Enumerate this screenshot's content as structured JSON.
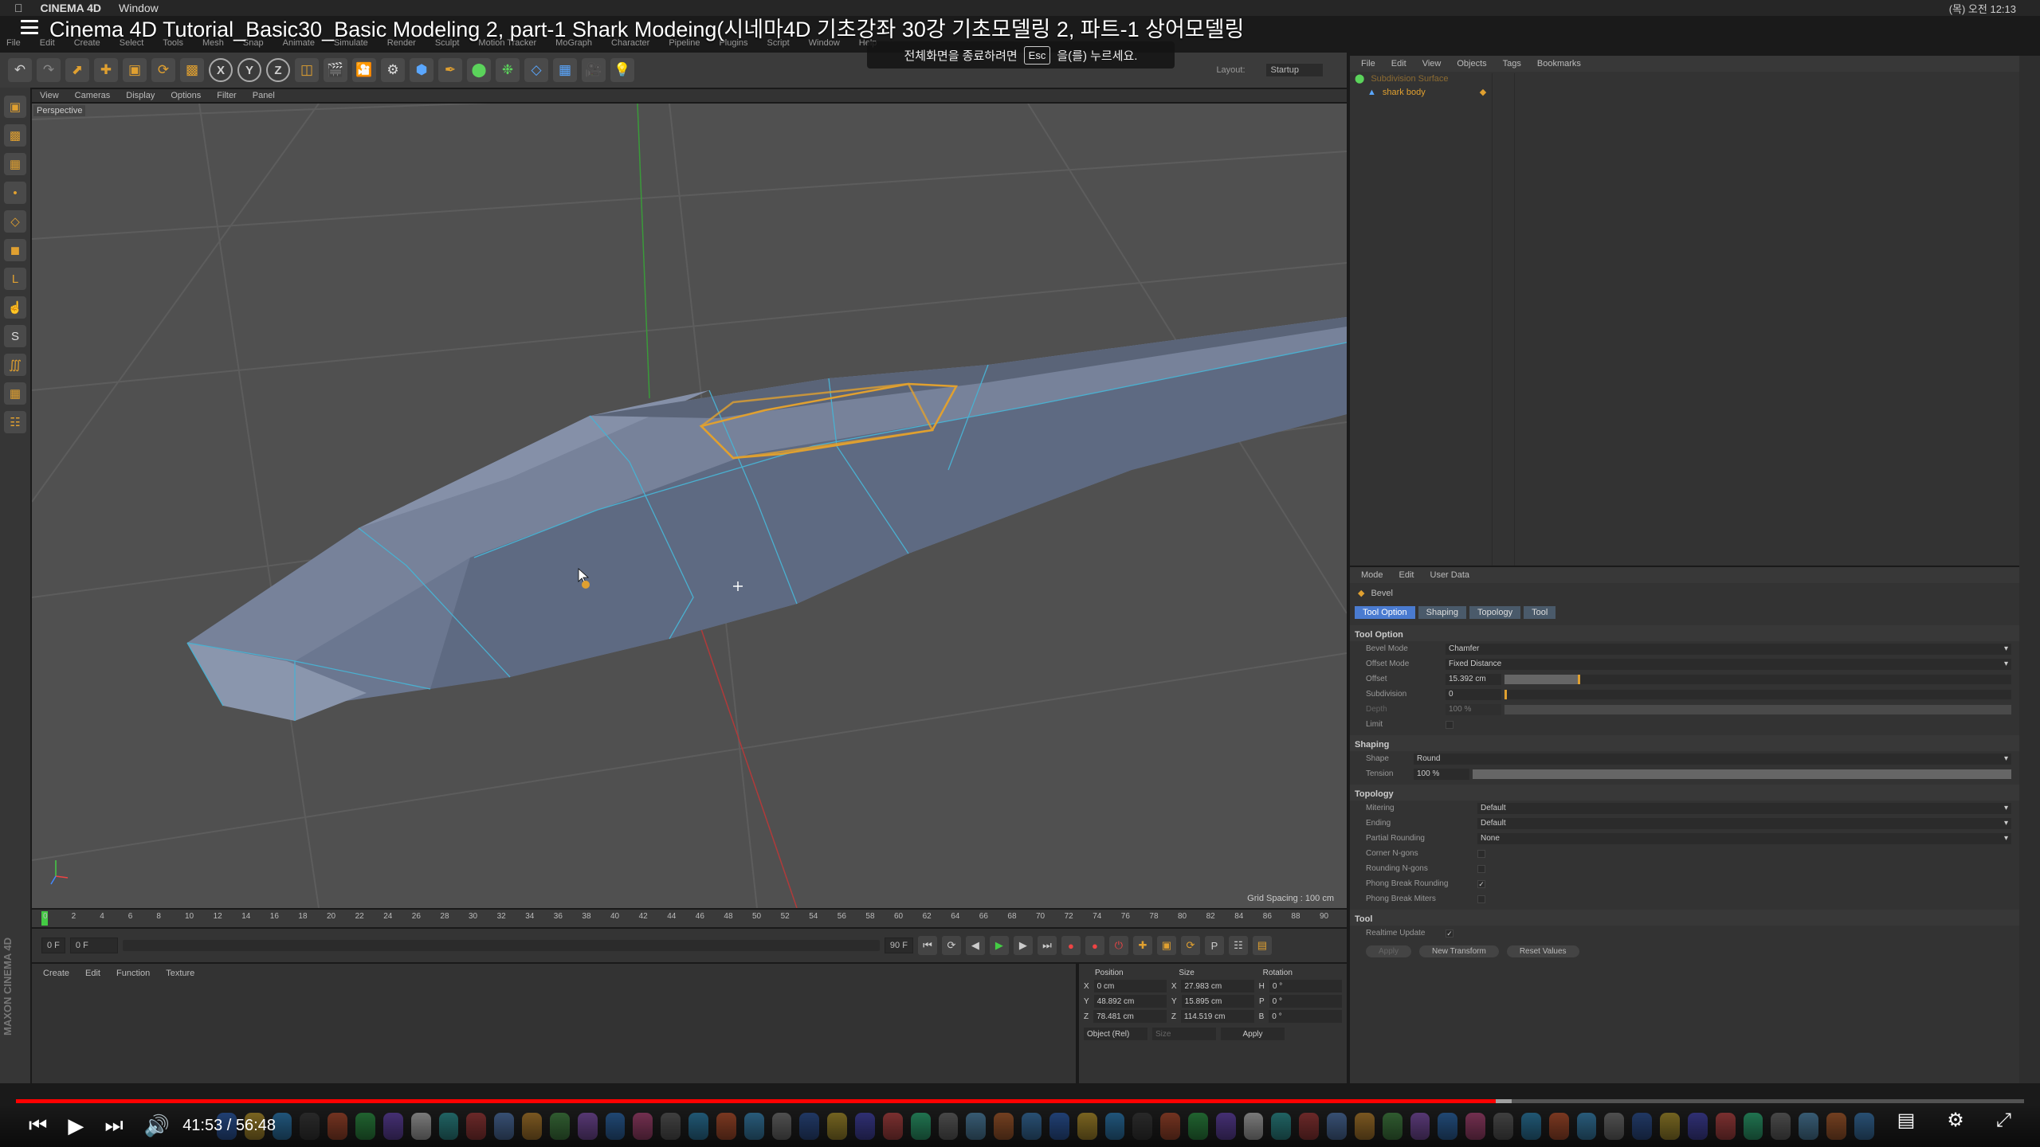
{
  "colors": {
    "selection": "#e0a030",
    "wire": "#4ab0d0",
    "shark": "#6b7790",
    "progress": "#ff0000"
  },
  "mac": {
    "app": "CINEMA 4D",
    "menu": "Window",
    "status": "(목) 오전 12:13"
  },
  "video": {
    "title": "Cinema 4D Tutorial_Basic30_Basic Modeling 2, part-1 Shark Modeing(시네마4D 기초강좌 30강 기초모델링 2, 파트-1 상어모델링",
    "esc_prefix": "전체화면을 종료하려면",
    "esc_key": "Esc",
    "esc_suffix": "을(를) 누르세요.",
    "current": "41:53",
    "duration": "56:48",
    "played_pct": 73.7,
    "buffered_pct": 74.5
  },
  "c4d": {
    "menu": [
      "File",
      "Edit",
      "Create",
      "Select",
      "Tools",
      "Mesh",
      "Snap",
      "Animate",
      "Simulate",
      "Render",
      "Sculpt",
      "Motion Tracker",
      "MoGraph",
      "Character",
      "Pipeline",
      "Plugins",
      "Script",
      "Window",
      "Help"
    ],
    "layout_label": "Layout:",
    "layout_value": "Startup",
    "viewport": {
      "menu": [
        "View",
        "Cameras",
        "Display",
        "Options",
        "Filter",
        "Panel"
      ],
      "label": "Perspective",
      "grid": "Grid Spacing : 100 cm"
    },
    "timeline": {
      "ticks": [
        "0",
        "2",
        "4",
        "6",
        "8",
        "10",
        "12",
        "14",
        "16",
        "18",
        "20",
        "22",
        "24",
        "26",
        "28",
        "30",
        "32",
        "34",
        "36",
        "38",
        "40",
        "42",
        "44",
        "46",
        "48",
        "50",
        "52",
        "54",
        "56",
        "58",
        "60",
        "62",
        "64",
        "66",
        "68",
        "70",
        "72",
        "74",
        "76",
        "78",
        "80",
        "82",
        "84",
        "86",
        "88",
        "90"
      ],
      "current": "0 F",
      "start": "0 F",
      "end": "90 F",
      "end2": "90 F"
    },
    "materials": {
      "menu": [
        "Create",
        "Edit",
        "Function",
        "Texture"
      ]
    },
    "coords": {
      "headers": [
        "Position",
        "Size",
        "Rotation"
      ],
      "rows": [
        {
          "a": "X",
          "p": "0 cm",
          "s": "27.983 cm",
          "r": "H",
          "rv": "0 °"
        },
        {
          "a": "Y",
          "p": "48.892 cm",
          "s": "15.895 cm",
          "r": "P",
          "rv": "0 °"
        },
        {
          "a": "Z",
          "p": "78.481 cm",
          "s": "114.519 cm",
          "r": "B",
          "rv": "0 °"
        }
      ],
      "mode": "Object (Rel)",
      "size": "Size",
      "apply": "Apply"
    },
    "objects": {
      "menu": [
        "File",
        "Edit",
        "View",
        "Objects",
        "Tags",
        "Bookmarks"
      ],
      "items": [
        "Subdivision Surface",
        "shark body"
      ]
    },
    "attributes": {
      "menu": [
        "Mode",
        "Edit",
        "User Data"
      ],
      "title": "Bevel",
      "tabs": [
        "Tool Option",
        "Shaping",
        "Topology",
        "Tool"
      ],
      "tool_option": "Tool Option",
      "bevel_mode_label": "Bevel Mode",
      "bevel_mode": "Chamfer",
      "offset_mode_label": "Offset Mode",
      "offset_mode": "Fixed Distance",
      "offset_label": "Offset",
      "offset": "15.392 cm",
      "offset_fill": 0.15,
      "subdivision_label": "Subdivision",
      "subdivision": "0",
      "depth_label": "Depth",
      "depth": "100 %",
      "limit_label": "Limit",
      "shaping": "Shaping",
      "shape_label": "Shape",
      "shape": "Round",
      "tension_label": "Tension",
      "tension": "100 %",
      "topology": "Topology",
      "mitering_label": "Mitering",
      "mitering": "Default",
      "ending_label": "Ending",
      "ending": "Default",
      "partial_label": "Partial Rounding",
      "partial": "None",
      "corner_label": "Corner N-gons",
      "rounding_label": "Rounding N-gons",
      "phong_round_label": "Phong Break Rounding",
      "phong_miter_label": "Phong Break Miters",
      "tool": "Tool",
      "realtime_label": "Realtime Update",
      "apply": "Apply",
      "new_transform": "New Transform",
      "reset": "Reset Values"
    }
  }
}
